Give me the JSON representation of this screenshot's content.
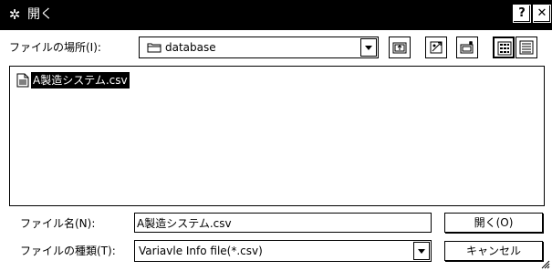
{
  "window": {
    "title": "開く",
    "title_icon": "✲",
    "help_label": "?",
    "close_label": "✕"
  },
  "location": {
    "label": "ファイルの場所(I):",
    "value": "database"
  },
  "toolbar": {
    "icons": [
      "up-folder-icon",
      "new-folder-icon",
      "desktop-icon",
      "list-view-icon",
      "details-view-icon"
    ]
  },
  "files": [
    {
      "name": "A製造システム.csv",
      "selected": true
    }
  ],
  "filename": {
    "label": "ファイル名(N):",
    "value": "A製造システム.csv"
  },
  "filetype": {
    "label": "ファイルの種類(T):",
    "value": "Variavle Info file(*.csv)"
  },
  "buttons": {
    "open": "開く(O)",
    "cancel": "キャンセル"
  },
  "colors": {
    "titlebar": "#000000",
    "background": "#ffffff",
    "selection": "#000000"
  }
}
